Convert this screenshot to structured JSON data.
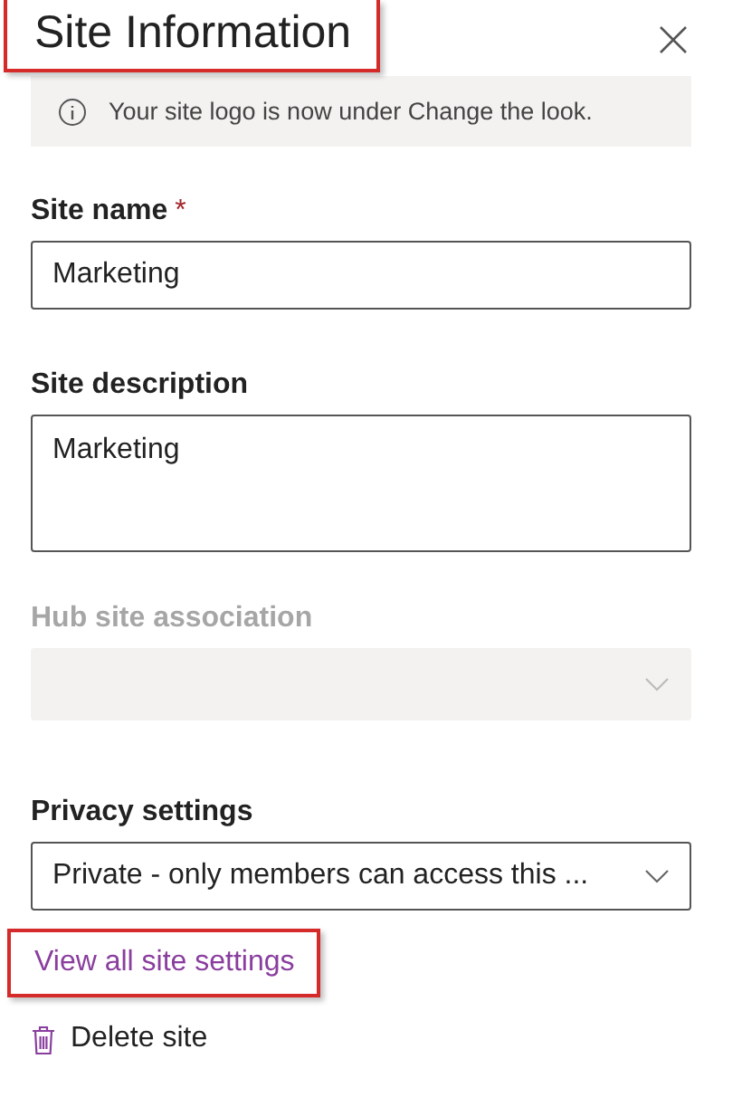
{
  "panel": {
    "title": "Site Information",
    "title_highlighted": true
  },
  "notice": {
    "text": "Your site logo is now under Change the look."
  },
  "fields": [
    {
      "kind": "text",
      "label": "Site name",
      "required_mark": "*",
      "value": "Marketing",
      "disabled": false
    },
    {
      "kind": "textarea",
      "label": "Site description",
      "value": "Marketing",
      "disabled": false
    },
    {
      "kind": "dropdown",
      "label": "Hub site association",
      "disabled": true
    },
    {
      "kind": "dropdown",
      "label": "Privacy settings",
      "value": "Private - only members can access this ...",
      "disabled": false
    }
  ],
  "link": {
    "text": "View all site settings",
    "highlighted": true
  },
  "delete_action": {
    "label": "Delete site"
  }
}
